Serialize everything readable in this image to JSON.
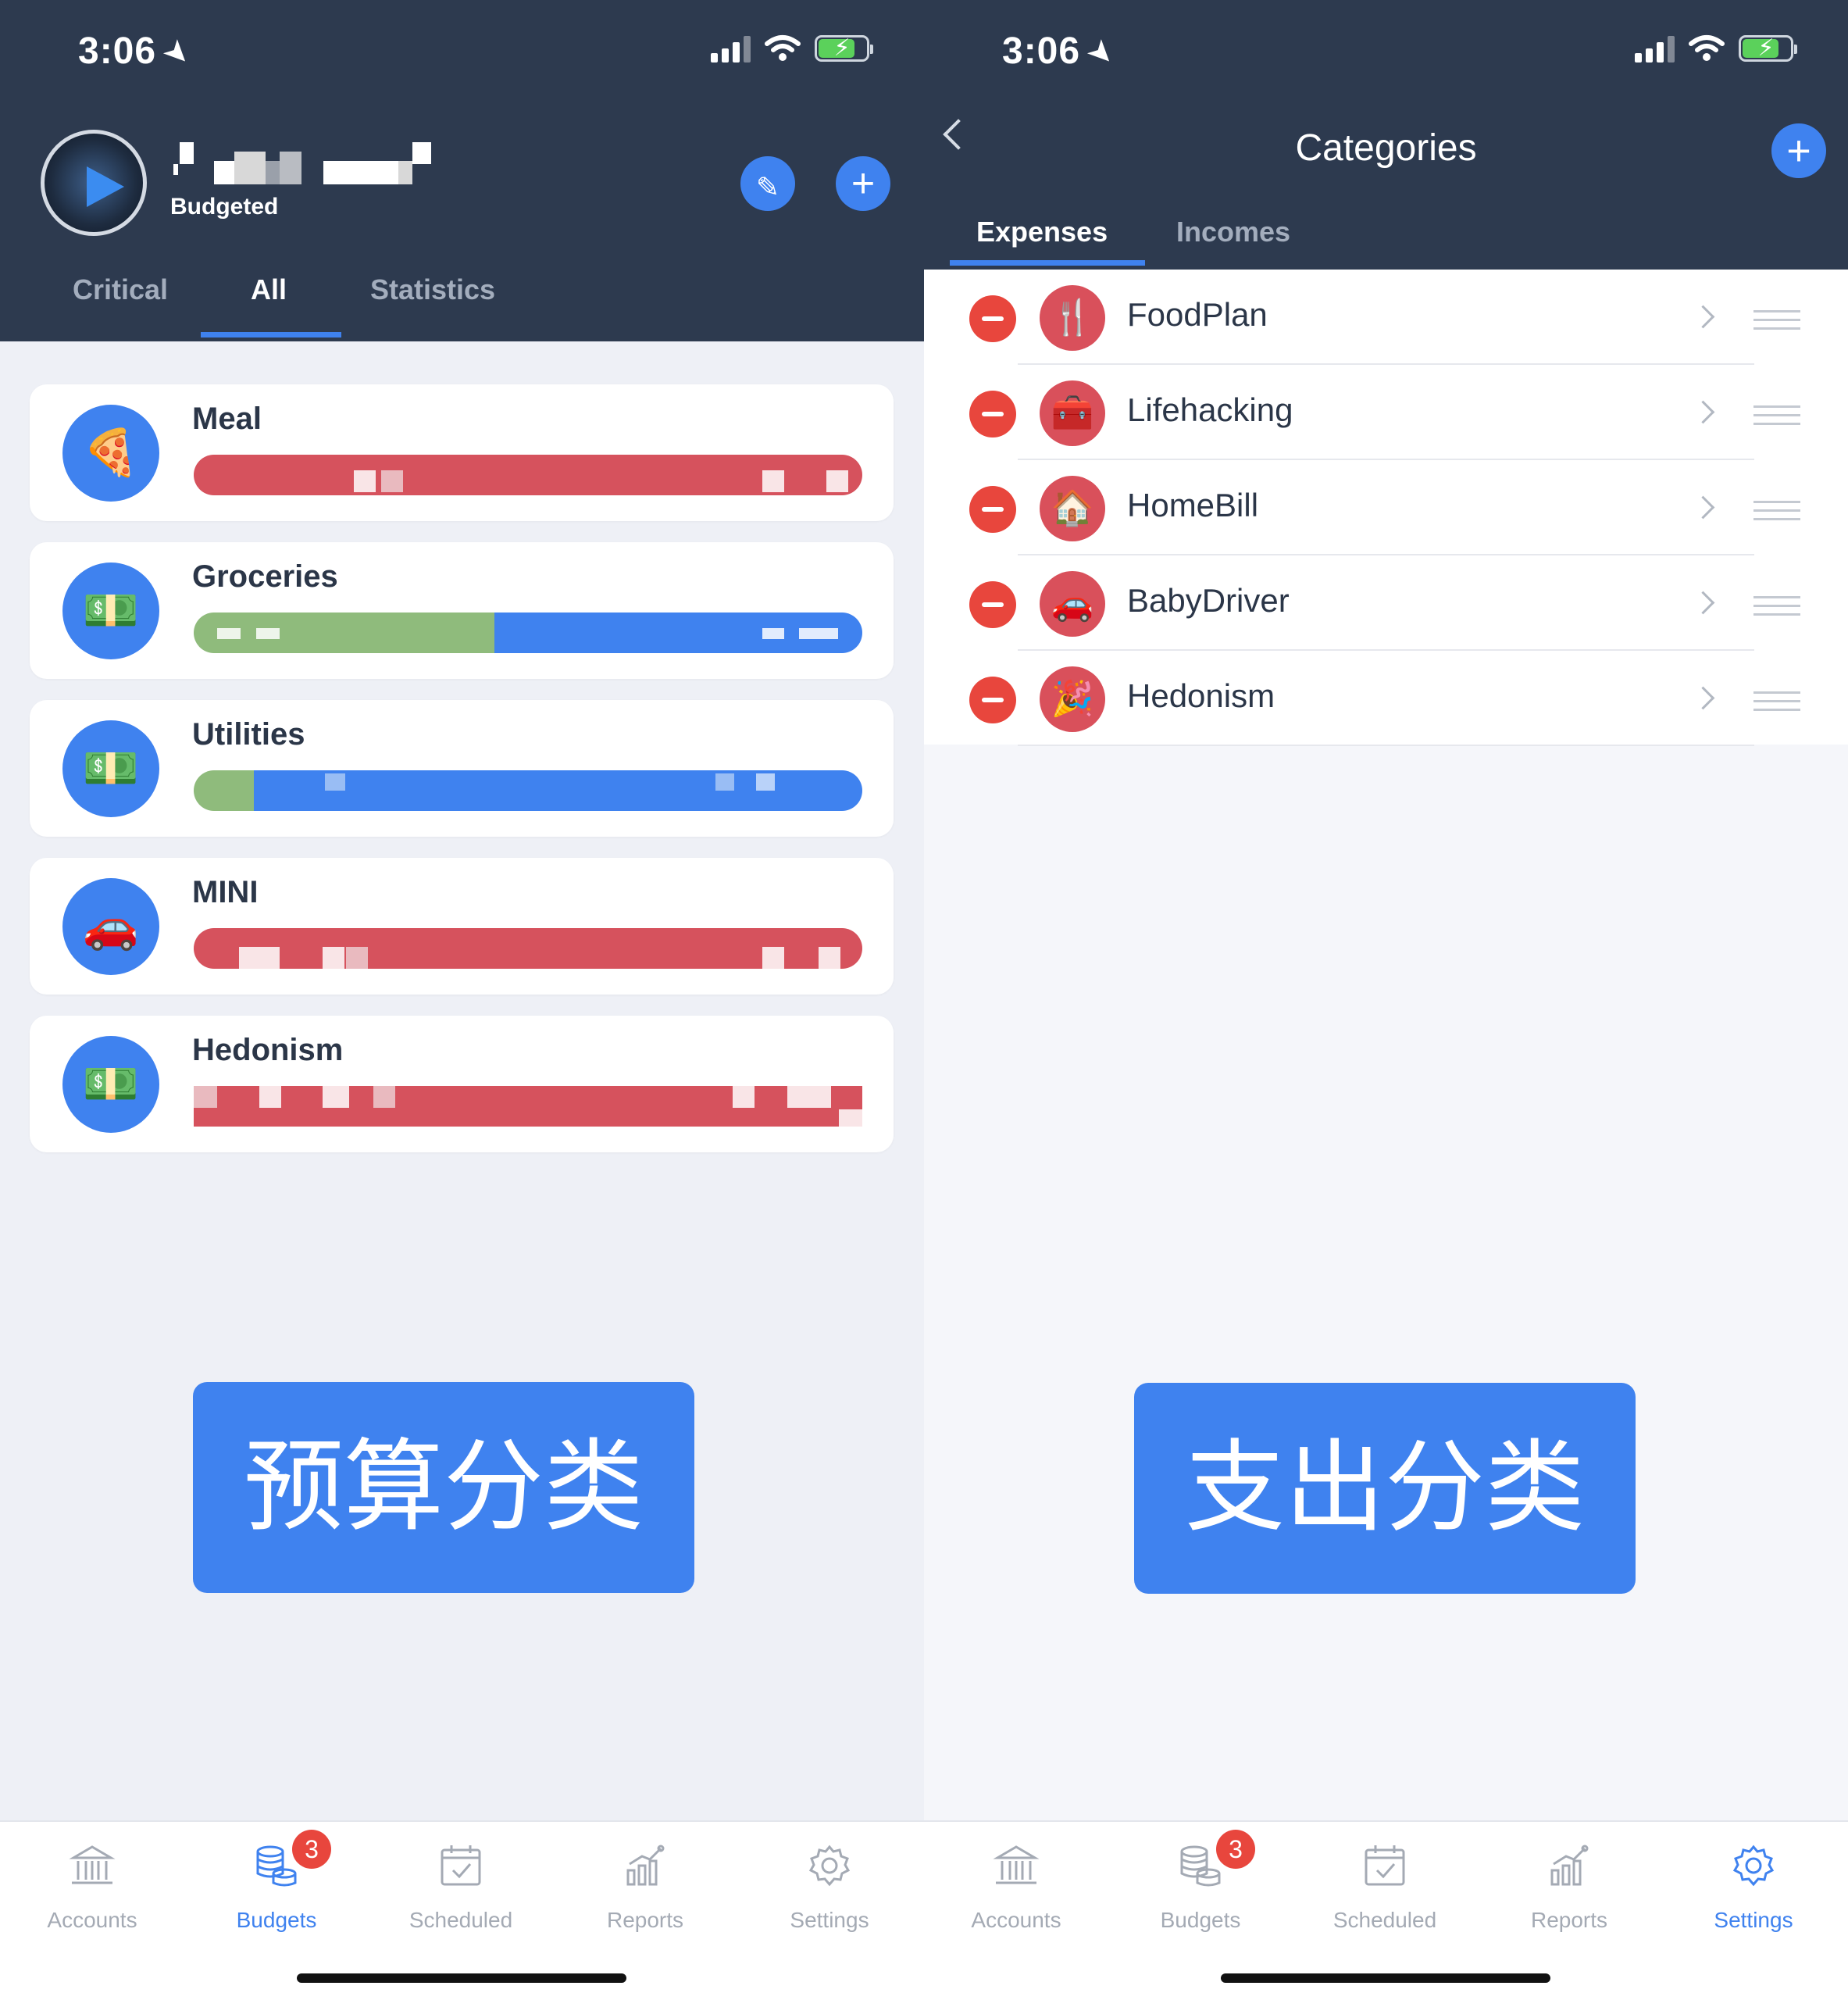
{
  "status_bar": {
    "time": "3:06"
  },
  "budgets_screen": {
    "header": {
      "subtitle": "Budgeted"
    },
    "tabs": [
      "Critical",
      "All",
      "Statistics"
    ],
    "active_tab": "All",
    "budgets": [
      {
        "name": "Meal",
        "icon": "pizza-icon",
        "bar_colors": [
          "#d6525d"
        ]
      },
      {
        "name": "Groceries",
        "icon": "money-icon",
        "bar_colors": [
          "#8fbb7c",
          "#3f82ef"
        ]
      },
      {
        "name": "Utilities",
        "icon": "money-icon",
        "bar_colors": [
          "#8fbb7c",
          "#3f82ef"
        ]
      },
      {
        "name": "MINI",
        "icon": "car-icon",
        "bar_colors": [
          "#d6525d"
        ]
      },
      {
        "name": "Hedonism",
        "icon": "money-icon",
        "bar_colors": [
          "#d6525d"
        ]
      }
    ],
    "overlay_label": "预算分类"
  },
  "categories_screen": {
    "title": "Categories",
    "tabs": [
      "Expenses",
      "Incomes"
    ],
    "active_tab": "Expenses",
    "categories": [
      {
        "name": "FoodPlan",
        "icon": "fork-knife-icon"
      },
      {
        "name": "Lifehacking",
        "icon": "first-aid-kit-icon"
      },
      {
        "name": "HomeBill",
        "icon": "house-icon"
      },
      {
        "name": "BabyDriver",
        "icon": "car-icon"
      },
      {
        "name": "Hedonism",
        "icon": "party-popper-icon"
      }
    ],
    "overlay_label": "支出分类"
  },
  "tab_bar": {
    "items": [
      "Accounts",
      "Budgets",
      "Scheduled",
      "Reports",
      "Settings"
    ],
    "badge_budgets": "3"
  },
  "colors": {
    "header": "#2d3a4f",
    "accent": "#3f82ef",
    "over_budget": "#d6525d",
    "spent": "#8fbb7c",
    "delete": "#e8463d"
  }
}
